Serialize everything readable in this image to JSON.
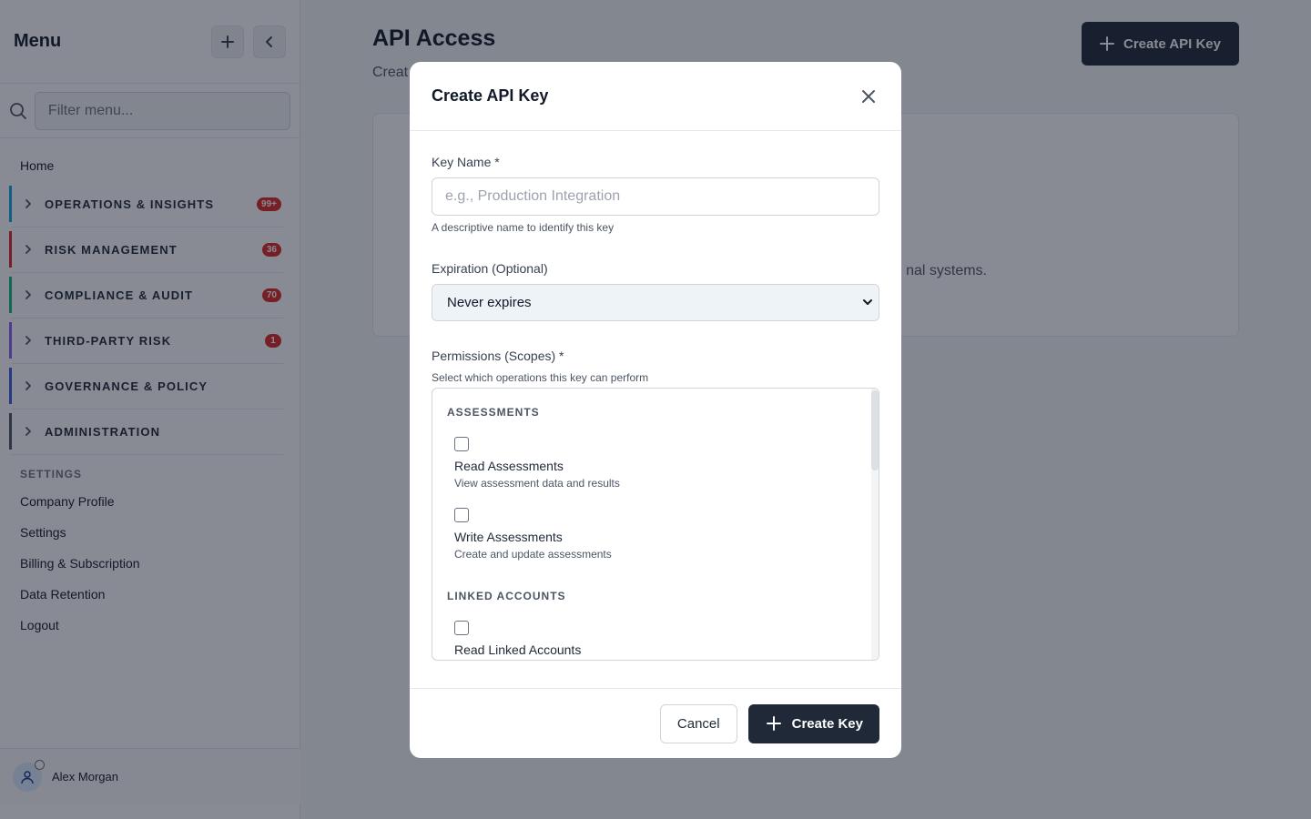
{
  "sidebar": {
    "title": "Menu",
    "filter_placeholder": "Filter menu...",
    "home": "Home",
    "groups": [
      {
        "label": "OPERATIONS & INSIGHTS",
        "badge": "99+",
        "color": "#0ea5e9"
      },
      {
        "label": "RISK MANAGEMENT",
        "badge": "36",
        "color": "#dc2626"
      },
      {
        "label": "COMPLIANCE & AUDIT",
        "badge": "70",
        "color": "#10b981"
      },
      {
        "label": "THIRD-PARTY RISK",
        "badge": "1",
        "color": "#8b5cf6"
      },
      {
        "label": "GOVERNANCE & POLICY",
        "badge": "",
        "color": "#3b5bdb"
      },
      {
        "label": "ADMINISTRATION",
        "badge": "",
        "color": "#4b5563"
      }
    ],
    "settings_header": "SETTINGS",
    "settings_links": [
      "Company Profile",
      "Settings",
      "Billing & Subscription",
      "Data Retention",
      "Logout"
    ],
    "user_name": "Alex Morgan"
  },
  "main": {
    "title": "API Access",
    "subtitle": "Creat",
    "create_button": "Create API Key",
    "card_text": "nal systems."
  },
  "modal": {
    "title": "Create API Key",
    "key_name_label": "Key Name *",
    "key_name_placeholder": "e.g., Production Integration",
    "key_name_help": "A descriptive name to identify this key",
    "expiration_label": "Expiration (Optional)",
    "expiration_value": "Never expires",
    "permissions_label": "Permissions (Scopes) *",
    "permissions_help": "Select which operations this key can perform",
    "categories": {
      "assessments": "ASSESSMENTS",
      "linked_accounts": "LINKED ACCOUNTS"
    },
    "scopes": {
      "read_assessments": {
        "name": "Read Assessments",
        "desc": "View assessment data and results"
      },
      "write_assessments": {
        "name": "Write Assessments",
        "desc": "Create and update assessments"
      },
      "read_linked_accounts": {
        "name": "Read Linked Accounts"
      }
    },
    "cancel_label": "Cancel",
    "create_label": "Create Key"
  }
}
